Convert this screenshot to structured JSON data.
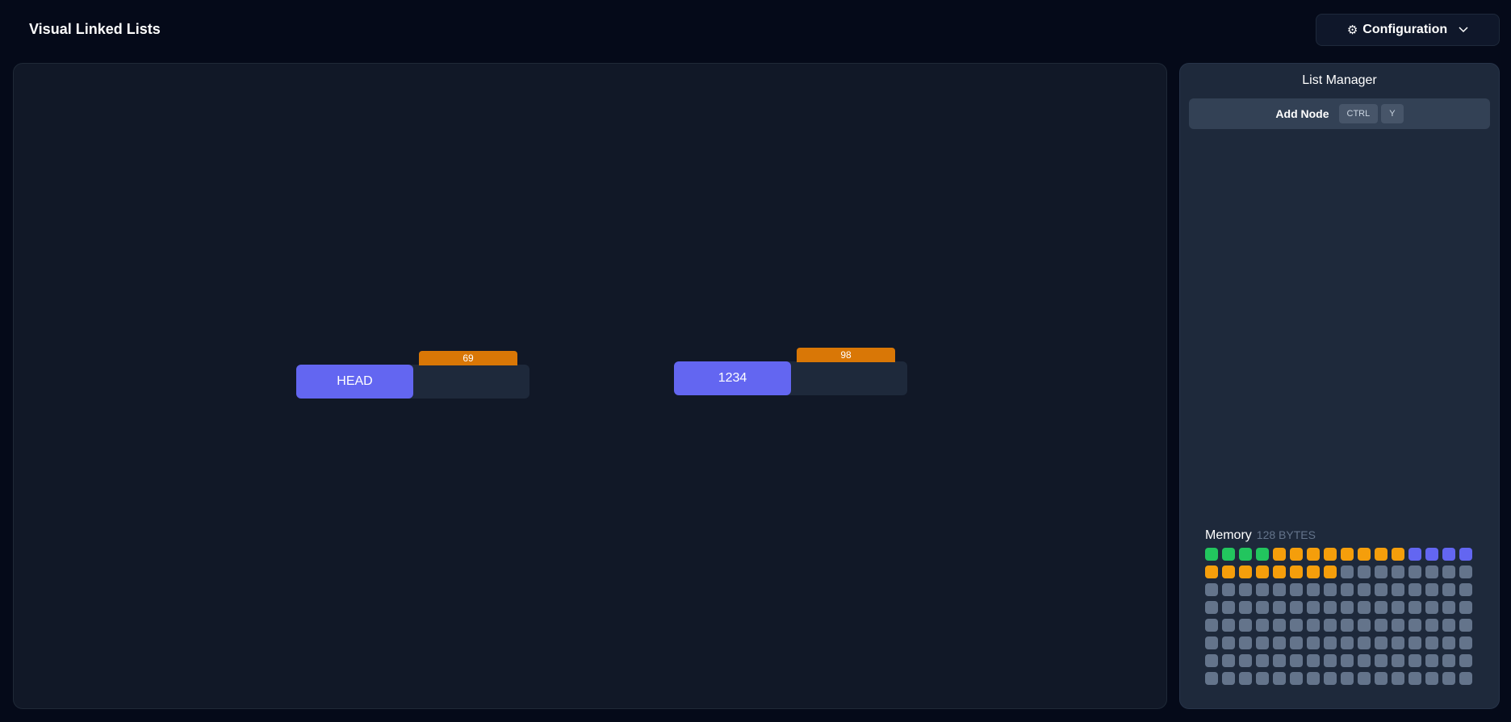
{
  "app": {
    "title": "Visual Linked Lists"
  },
  "config": {
    "label": "Configuration",
    "gear_icon": "gear-icon",
    "chevron_icon": "chevron-down-icon"
  },
  "nodes": [
    {
      "value": "HEAD",
      "address": "69"
    },
    {
      "value": "1234",
      "address": "98"
    }
  ],
  "panel": {
    "title": "List Manager",
    "add_node": {
      "label": "Add Node",
      "shortcut": [
        "CTRL",
        "Y"
      ]
    },
    "memory": {
      "label": "Memory",
      "size": "128 BYTES",
      "cells": [
        "green",
        "green",
        "green",
        "green",
        "orange",
        "orange",
        "orange",
        "orange",
        "orange",
        "orange",
        "orange",
        "orange",
        "indigo",
        "indigo",
        "indigo",
        "indigo",
        "orange",
        "orange",
        "orange",
        "orange",
        "orange",
        "orange",
        "orange",
        "orange",
        "free",
        "free",
        "free",
        "free",
        "free",
        "free",
        "free",
        "free",
        "free",
        "free",
        "free",
        "free",
        "free",
        "free",
        "free",
        "free",
        "free",
        "free",
        "free",
        "free",
        "free",
        "free",
        "free",
        "free",
        "free",
        "free",
        "free",
        "free",
        "free",
        "free",
        "free",
        "free",
        "free",
        "free",
        "free",
        "free",
        "free",
        "free",
        "free",
        "free",
        "free",
        "free",
        "free",
        "free",
        "free",
        "free",
        "free",
        "free",
        "free",
        "free",
        "free",
        "free",
        "free",
        "free",
        "free",
        "free",
        "free",
        "free",
        "free",
        "free",
        "free",
        "free",
        "free",
        "free",
        "free",
        "free",
        "free",
        "free",
        "free",
        "free",
        "free",
        "free",
        "free",
        "free",
        "free",
        "free",
        "free",
        "free",
        "free",
        "free",
        "free",
        "free",
        "free",
        "free",
        "free",
        "free",
        "free",
        "free",
        "free",
        "free",
        "free",
        "free",
        "free",
        "free",
        "free",
        "free",
        "free",
        "free",
        "free",
        "free",
        "free",
        "free",
        "free",
        "free"
      ]
    }
  },
  "colors": {
    "background": "#050a19",
    "canvas": "#111827",
    "panel": "#1e293b",
    "node_value": "#6366f1",
    "node_address": "#d97706",
    "mem_green": "#22c55e",
    "mem_orange": "#f59e0b",
    "mem_indigo": "#6366f1",
    "mem_free": "#64748b"
  }
}
